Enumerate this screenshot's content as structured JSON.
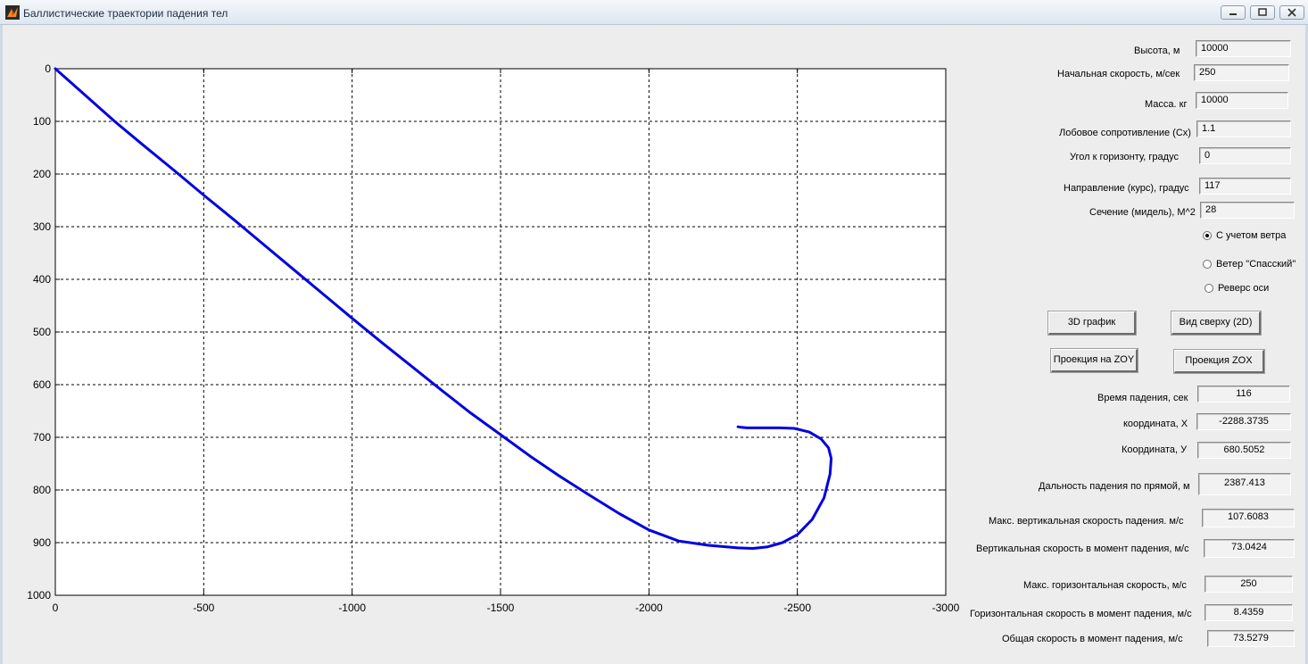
{
  "window": {
    "title": "Баллистические траектории падения тел"
  },
  "chart_data": {
    "type": "line",
    "xlim": [
      0,
      -3000
    ],
    "ylim": [
      0,
      1000
    ],
    "x_ticks": [
      "0",
      "-500",
      "-1000",
      "-1500",
      "-2000",
      "-2500",
      "-3000"
    ],
    "y_ticks": [
      "0",
      "100",
      "200",
      "300",
      "400",
      "500",
      "600",
      "700",
      "800",
      "900",
      "1000"
    ],
    "grid": true,
    "y_axis_reversed": true,
    "line_color": "#0000e0",
    "series": [
      {
        "x": [
          0,
          -100,
          -200,
          -300,
          -400,
          -500,
          -600,
          -700,
          -800,
          -900,
          -1000,
          -1100,
          -1200,
          -1300,
          -1400,
          -1500,
          -1600,
          -1700,
          -1800,
          -1900,
          -2000,
          -2100,
          -2200,
          -2300,
          -2350,
          -2400,
          -2450,
          -2500,
          -2550,
          -2590,
          -2610,
          -2614,
          -2605,
          -2580,
          -2540,
          -2490,
          -2440,
          -2400,
          -2360,
          -2330,
          -2310,
          -2300
        ],
        "y": [
          0,
          50,
          100,
          147,
          193,
          240,
          286,
          333,
          380,
          427,
          474,
          520,
          565,
          610,
          654,
          695,
          736,
          774,
          810,
          845,
          876,
          897,
          905,
          910,
          911,
          908,
          900,
          885,
          856,
          815,
          770,
          740,
          720,
          703,
          690,
          683,
          682,
          682,
          682,
          682,
          681,
          680
        ]
      }
    ]
  },
  "panel": {
    "fields": [
      {
        "label": "Высота, м",
        "value": "10000"
      },
      {
        "label": "Начальная скорость, м/сек",
        "value": "250"
      },
      {
        "label": "Масса. кг",
        "value": "10000"
      },
      {
        "label": "Лобовое сопротивление (Cx)",
        "value": "1.1"
      },
      {
        "label": "Угол к горизонту, градус",
        "value": "0"
      },
      {
        "label": "Направление  (курс), градус",
        "value": "117"
      },
      {
        "label": "Сечение (мидель), М^2",
        "value": "28"
      }
    ],
    "radios": [
      {
        "label": "С учетом ветра",
        "selected": true
      },
      {
        "label": "Ветер \"Спасский\"",
        "selected": false
      },
      {
        "label": "Реверс оси",
        "selected": false
      }
    ],
    "buttons": {
      "plot3d": "3D график",
      "top_view": "Вид сверху (2D)",
      "proj_zoy": "Проекция на ZOY",
      "proj_zox": "Проекция ZOX"
    },
    "results": [
      {
        "label": "Время падения, сек",
        "value": "116"
      },
      {
        "label": "координата, X",
        "value": "-2288.3735"
      },
      {
        "label": "Координата, У",
        "value": "680.5052"
      },
      {
        "label": "Дальность падения по прямой, м",
        "value": "2387.413"
      },
      {
        "label": "Макс.  вертикальная скорость падения. м/с",
        "value": "107.6083"
      },
      {
        "label": "Вертикальная  скорость в момент падения, м/с",
        "value": "73.0424"
      },
      {
        "label": "Макс. горизонтальная скорость, м/с",
        "value": "250"
      },
      {
        "label": "Горизонтальная скорость в момент падения, м/с",
        "value": "8.4359"
      },
      {
        "label": "Общая скорость в момент падения, м/с",
        "value": "73.5279"
      }
    ]
  }
}
